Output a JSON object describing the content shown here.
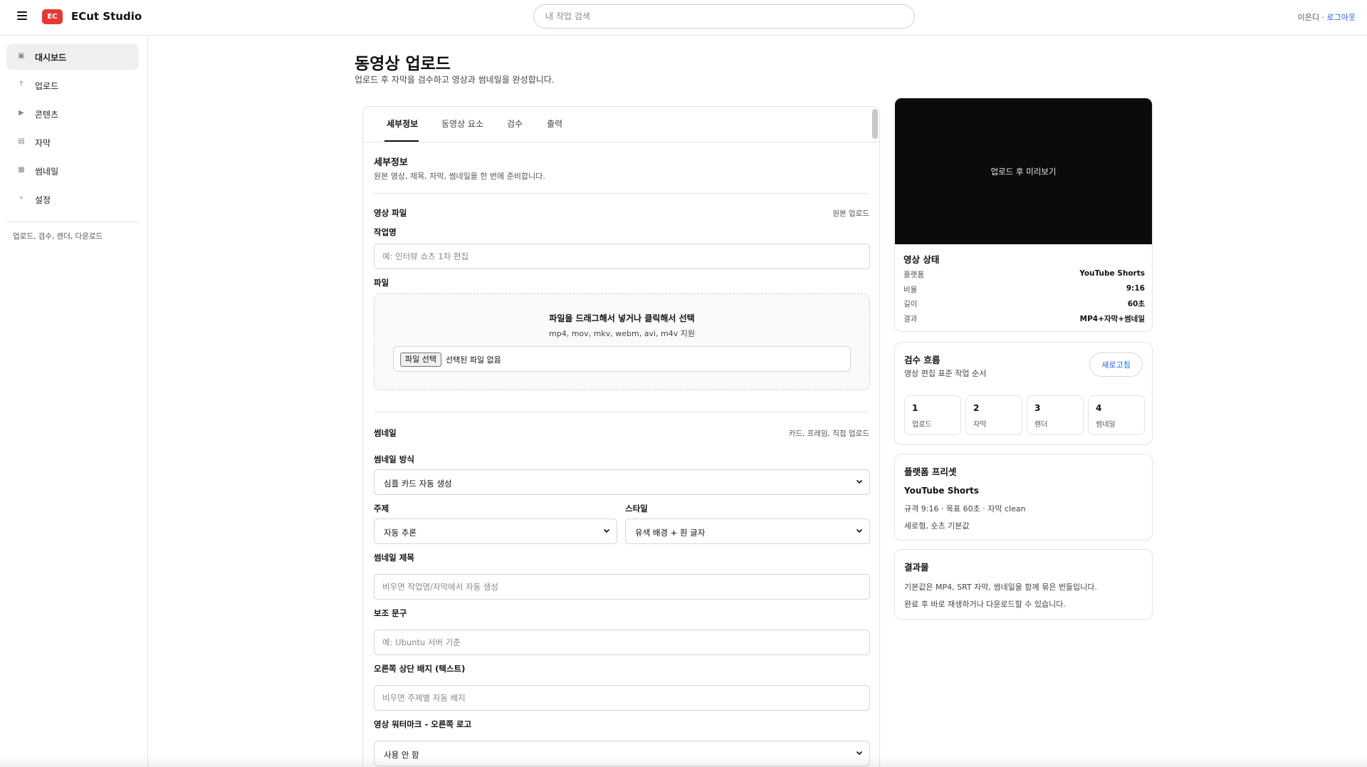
{
  "topbar": {
    "menu_icon": "hamburger-menu-icon",
    "logo_badge": "EC",
    "logo_color": "#e53935",
    "app_title": "ECut Studio",
    "search_placeholder": "내 작업 검색",
    "user_name": "이은디",
    "user_separator": " · ",
    "logout_label": "로그아웃"
  },
  "sidebar": {
    "items": [
      {
        "label": "대시보드",
        "icon": "▣",
        "icon_name": "dashboard-icon",
        "active": true
      },
      {
        "label": "업로드",
        "icon": "↑",
        "icon_name": "upload-icon",
        "active": false
      },
      {
        "label": "콘텐츠",
        "icon": "▶",
        "icon_name": "play-icon",
        "active": false
      },
      {
        "label": "자막",
        "icon": "▤",
        "icon_name": "subtitle-icon",
        "active": false
      },
      {
        "label": "썸네일",
        "icon": "▦",
        "icon_name": "thumbnail-icon",
        "active": false
      },
      {
        "label": "설정",
        "icon": "⚬",
        "icon_name": "settings-icon",
        "active": false
      }
    ],
    "note": "업로드, 검수, 렌더, 다운로드"
  },
  "page": {
    "title": "동영상 업로드",
    "subtitle": "업로드 후 자막을 검수하고 영상과 썸네일을 완성합니다."
  },
  "tabs": [
    "세부정보",
    "동영상 요소",
    "검수",
    "출력"
  ],
  "details": {
    "title": "세부정보",
    "desc": "원본 영상, 제목, 자막, 썸네일을 한 번에 준비합니다.",
    "video_file_label": "영상 파일",
    "video_file_note": "원본 업로드",
    "job_name_label": "작업명",
    "job_name_placeholder": "예: 인터뷰 쇼츠 1차 편집",
    "file_label": "파일",
    "dropzone_title": "파일을 드래그해서 넣거나 클릭해서 선택",
    "dropzone_formats": "mp4, mov, mkv, webm, avi, m4v 지원",
    "file_button": "파일 선택",
    "file_status": "선택된 파일 없음"
  },
  "thumbnail": {
    "title": "썸네일",
    "note": "카드, 프레임, 직접 업로드",
    "method_label": "썸네일 방식",
    "method_value": "심플 카드 자동 생성",
    "topic_label": "주제",
    "topic_value": "자동 추론",
    "style_label": "스타일",
    "style_value": "유색 배경 + 흰 글자",
    "thumb_title_label": "썸네일 제목",
    "thumb_title_placeholder": "비우면 작업명/자막에서 자동 생성",
    "sub_text_label": "보조 문구",
    "sub_text_placeholder": "예: Ubuntu 서버 기준",
    "badge_label": "오른쪽 상단 배지 (텍스트)",
    "badge_placeholder": "비우면 주제별 자동 배지",
    "watermark_label": "영상 워터마크 - 오른쪽 로고",
    "watermark_value": "사용 안 함"
  },
  "preview": {
    "placeholder": "업로드 후 미리보기",
    "status_title": "영상 상태",
    "rows": [
      {
        "key": "플랫폼",
        "value": "YouTube Shorts"
      },
      {
        "key": "비율",
        "value": "9:16"
      },
      {
        "key": "길이",
        "value": "60초"
      },
      {
        "key": "결과",
        "value": "MP4+자막+썸네일"
      }
    ]
  },
  "review_flow": {
    "title": "검수 흐름",
    "desc": "영상 편집 표준 작업 순서",
    "refresh_label": "새로고침",
    "accent_color": "#2563eb",
    "steps": [
      {
        "num": "1",
        "label": "업로드"
      },
      {
        "num": "2",
        "label": "자막"
      },
      {
        "num": "3",
        "label": "렌더"
      },
      {
        "num": "4",
        "label": "썸네일"
      }
    ]
  },
  "preset": {
    "title": "플랫폼 프리셋",
    "name": "YouTube Shorts",
    "spec": "규격 9:16 · 목표 60초 · 자막 clean",
    "note": "세로형, 숏츠 기본값"
  },
  "result": {
    "title": "결과물",
    "line1": "기본값은 MP4, SRT 자막, 썸네일을 함께 묶은 번들입니다.",
    "line2": "완료 후 바로 재생하거나 다운로드할 수 있습니다."
  }
}
